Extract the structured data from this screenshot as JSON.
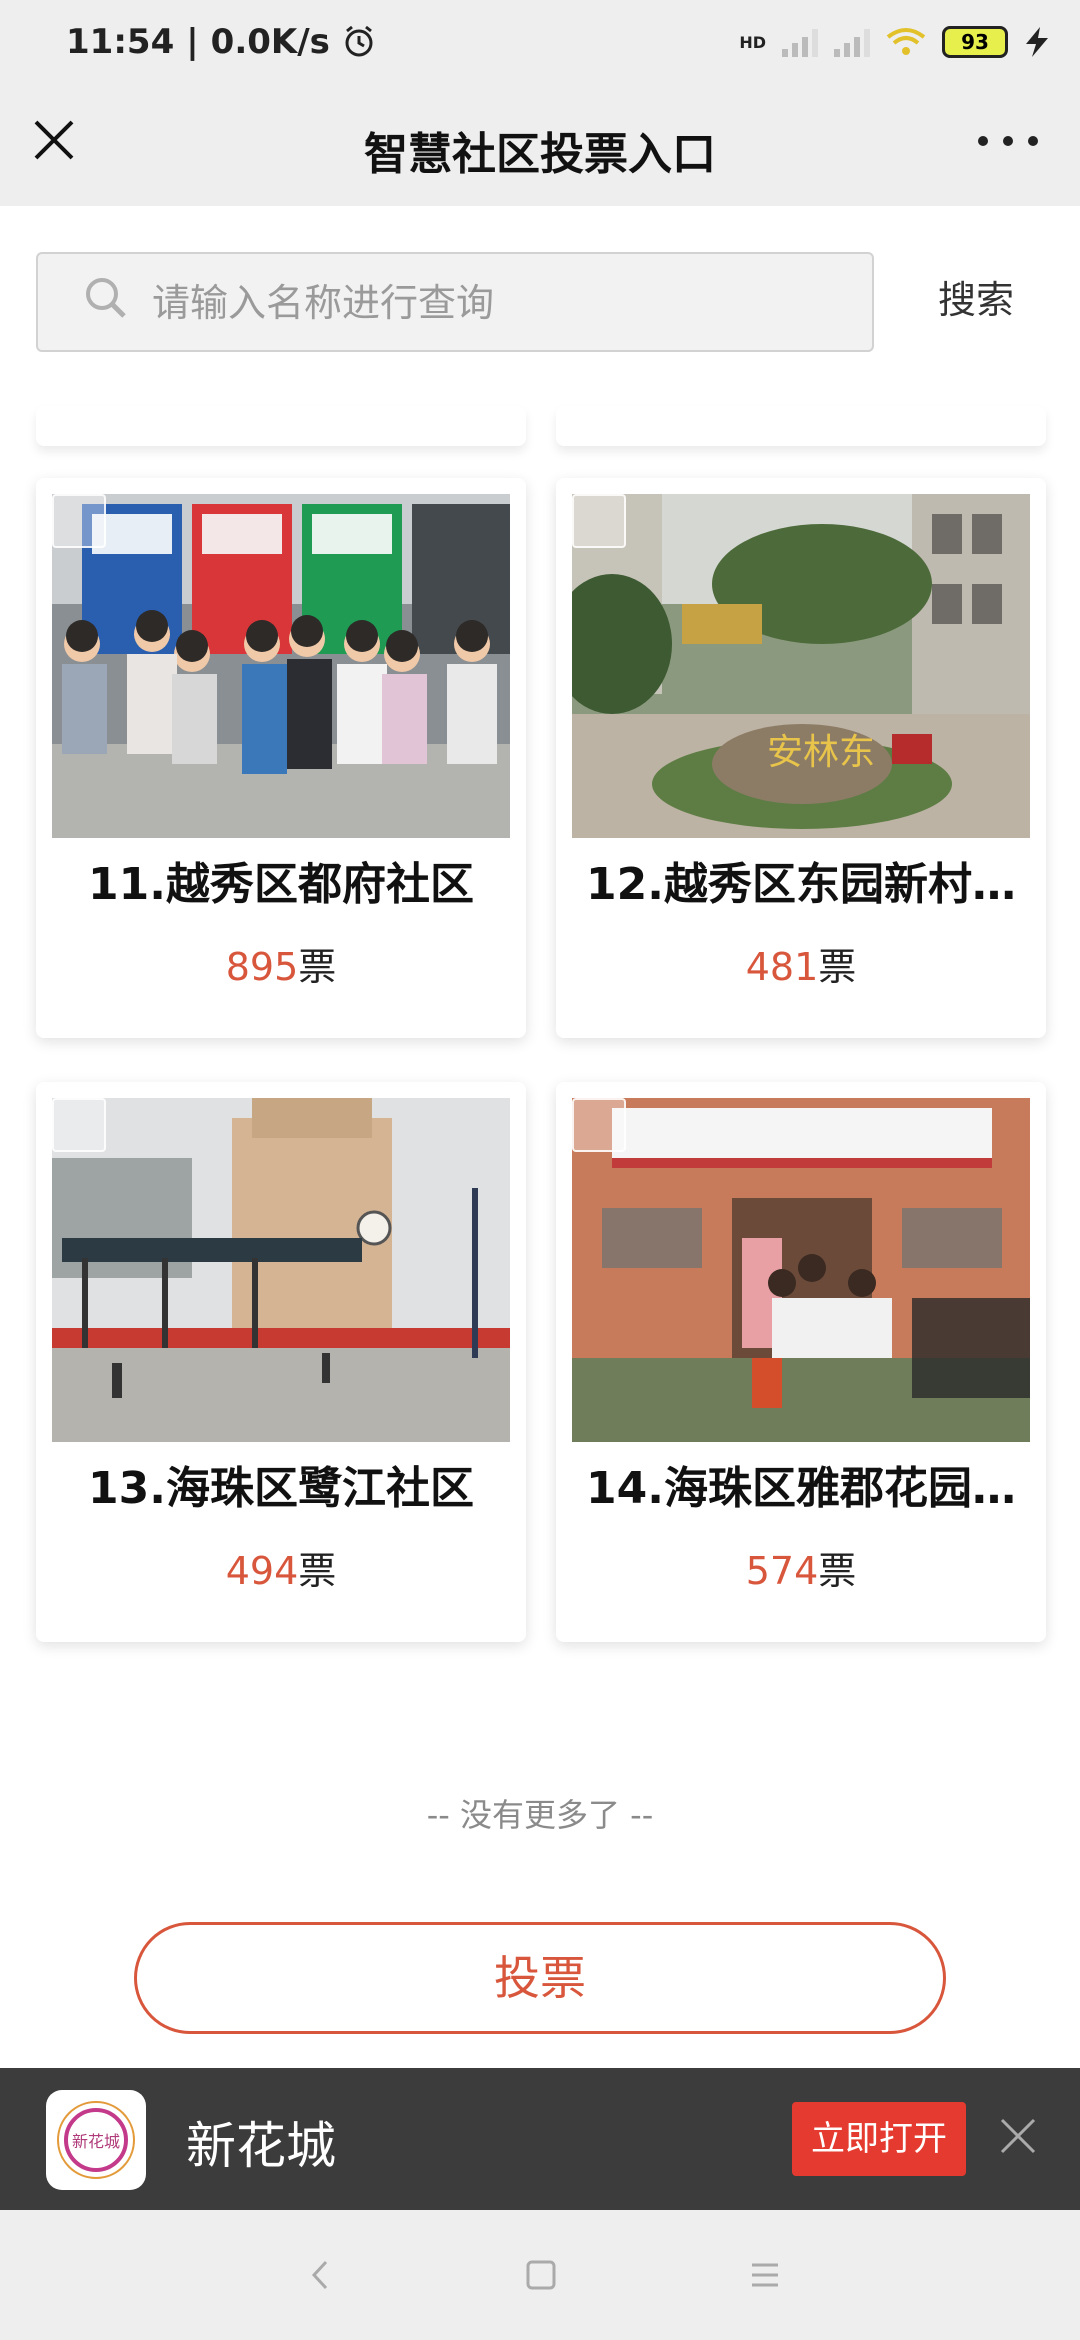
{
  "status_bar": {
    "time": "11:54",
    "net_speed": "0.0K/s",
    "battery": "93",
    "hd_label": "HD",
    "icons": [
      "alarm-icon",
      "signal-icon",
      "wifi-icon",
      "battery-icon",
      "charging-icon"
    ]
  },
  "nav": {
    "title": "智慧社区投票入口",
    "icons": [
      "close-icon",
      "more-icon"
    ]
  },
  "search": {
    "placeholder": "请输入名称进行查询",
    "button_label": "搜索"
  },
  "cards": [
    {
      "title": "11.越秀区都府社区",
      "votes": "895",
      "vote_unit": "票",
      "image": "garbage-bins-children-photo"
    },
    {
      "title": "12.越秀区东园新村…",
      "votes": "481",
      "vote_unit": "票",
      "image": "community-garden-photo"
    },
    {
      "title": "13.海珠区鹭江社区",
      "votes": "494",
      "vote_unit": "票",
      "image": "school-building-photo"
    },
    {
      "title": "14.海珠区雅郡花园…",
      "votes": "574",
      "vote_unit": "票",
      "image": "service-center-group-photo"
    }
  ],
  "no_more_text": "-- 没有更多了 --",
  "vote_button": "投票",
  "app_banner": {
    "app_name": "新花城",
    "logo_text": "新花城",
    "open_button": "立即打开"
  },
  "colors": {
    "accent": "#d8573c",
    "open_button": "#e53a2f",
    "banner_bg": "#3c3c3c"
  }
}
